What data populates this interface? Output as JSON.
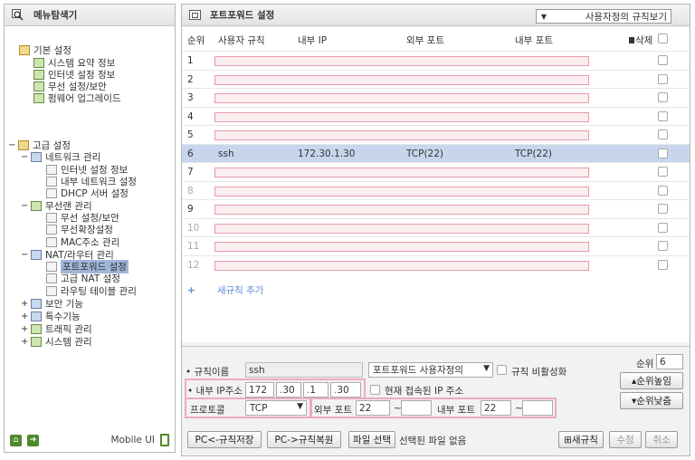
{
  "left": {
    "title": "메뉴탐색기",
    "basic": {
      "label": "기본 설정",
      "items": [
        "시스템 요약 정보",
        "인터넷 설정 정보",
        "무선 설정/보안",
        "펌웨어 업그레이드"
      ]
    },
    "advanced": {
      "label": "고급 설정",
      "network": {
        "label": "네트워크 관리",
        "items": [
          "인터넷 설정 정보",
          "내부 네트워크 설정",
          "DHCP 서버 설정"
        ]
      },
      "wireless": {
        "label": "무선랜 관리",
        "items": [
          "무선 설정/보안",
          "무선확장설정",
          "MAC주소 관리"
        ]
      },
      "nat": {
        "label": "NAT/라우터 관리",
        "items": [
          "포트포워드 설정",
          "고급 NAT 설정",
          "라우팅 테이블 관리"
        ]
      },
      "others": [
        "보안 기능",
        "특수기능",
        "트래픽 관리",
        "시스템 관리"
      ]
    },
    "footer": {
      "mobile": "Mobile UI"
    }
  },
  "main": {
    "title": "포트포워드 설정",
    "rule_select": "사용자정의 규칙보기",
    "headers": {
      "order": "순위",
      "rule": "사용자 규칙",
      "internal_ip": "내부 IP",
      "external_port": "외부 포트",
      "internal_port": "내부 포트",
      "delete": "삭제"
    },
    "rows": [
      {
        "no": "1"
      },
      {
        "no": "2"
      },
      {
        "no": "3"
      },
      {
        "no": "4"
      },
      {
        "no": "5"
      },
      {
        "no": "6",
        "rule": "ssh",
        "ip": "172.30.1.30",
        "ext": "TCP(22)",
        "int": "TCP(22)"
      },
      {
        "no": "7"
      },
      {
        "no": "8"
      },
      {
        "no": "9"
      },
      {
        "no": "10"
      },
      {
        "no": "11"
      },
      {
        "no": "12"
      }
    ],
    "add_rule": {
      "plus": "+",
      "label": "새규칙 추가"
    }
  },
  "form": {
    "rule_name_label": "• 규칙이름",
    "rule_name": "ssh",
    "rule_type": "포트포워드 사용자정의",
    "disable_label": "규칙 비활성화",
    "ip_label": "• 내부 IP주소",
    "ip": [
      "172",
      "30",
      "1",
      "30"
    ],
    "current_ip_label": "현재 접속된 IP 주소",
    "protocol_label": "프로토콜",
    "protocol": "TCP",
    "ext_port_label": "외부 포트",
    "ext_port_from": "22",
    "int_port_label": "내부 포트",
    "int_port_from": "22",
    "tilde": "~",
    "order_label": "순위",
    "order": "6",
    "order_up": "▴순위높임",
    "order_down": "▾순위낮춤",
    "buttons": {
      "save_pc": "PC<-규칙저장",
      "restore_pc": "PC->규칙복원",
      "file_select": "파일 선택",
      "no_file": "선택된 파일 없음",
      "new_rule": "⊞새규칙",
      "modify": "수정",
      "cancel": "취소"
    }
  },
  "colors": {
    "highlight_row": "#c7d6ec",
    "mask": "#e79aa8",
    "accent_green": "#4f8a2b",
    "link_blue": "#5d8cd4"
  }
}
